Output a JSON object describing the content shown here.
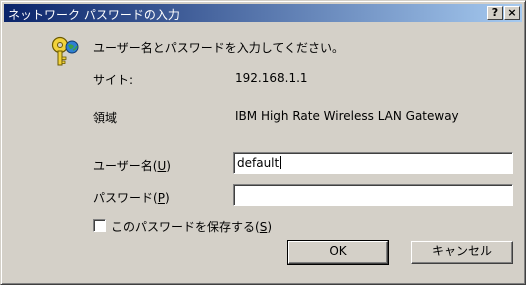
{
  "window": {
    "title": "ネットワーク パスワードの入力",
    "help_button": "?",
    "close_button": "×"
  },
  "dialog": {
    "prompt": "ユーザー名とパスワードを入力してください。",
    "site_label": "サイト:",
    "site_value": "192.168.1.1",
    "realm_label": "領域",
    "realm_value": "IBM High Rate Wireless LAN Gateway",
    "username_label": "ユーザー名",
    "username_accel": "U",
    "username_value": "default",
    "password_label": "パスワード",
    "password_accel": "P",
    "password_value": "",
    "save_password_label": "このパスワードを保存する",
    "save_password_accel": "S",
    "save_password_checked": false,
    "ok_button": "OK",
    "cancel_button": "キャンセル"
  },
  "icons": {
    "dialog_icon": "key-icon"
  }
}
